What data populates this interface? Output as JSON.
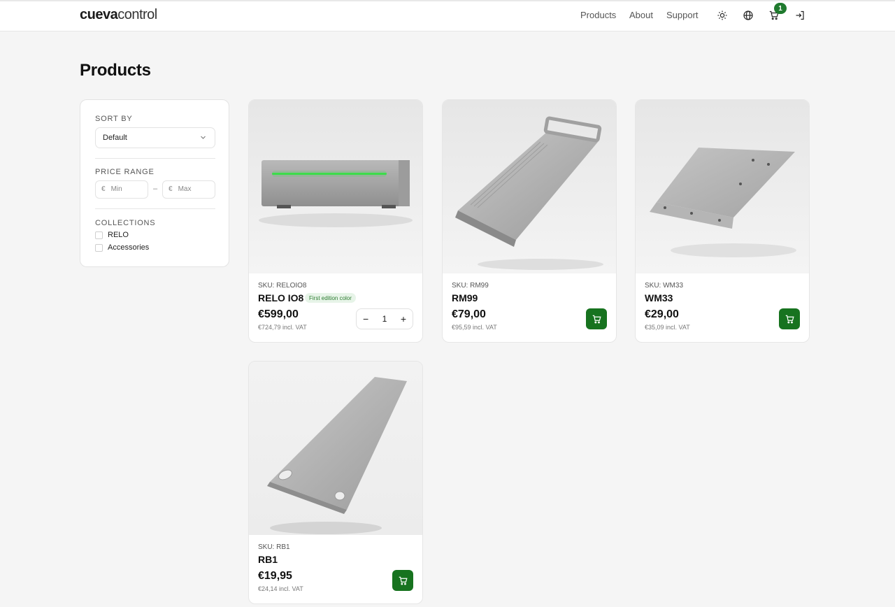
{
  "header": {
    "logo_bold": "cueva",
    "logo_light": "control",
    "nav": [
      "Products",
      "About",
      "Support"
    ],
    "cart_count": "1"
  },
  "page": {
    "title": "Products"
  },
  "filters": {
    "sort_label": "SORT BY",
    "sort_value": "Default",
    "price_label": "PRICE RANGE",
    "currency": "€",
    "min_placeholder": "Min",
    "max_placeholder": "Max",
    "price_separator": "–",
    "collections_label": "COLLECTIONS",
    "collections": [
      "RELO",
      "Accessories"
    ]
  },
  "products": [
    {
      "sku": "SKU: RELOIO8",
      "name": "RELO IO8",
      "badge": "First edition color",
      "price": "€599,00",
      "vat": "€724,79 incl. VAT",
      "quantity": "1"
    },
    {
      "sku": "SKU: RM99",
      "name": "RM99",
      "price": "€79,00",
      "vat": "€95,59 incl. VAT"
    },
    {
      "sku": "SKU: WM33",
      "name": "WM33",
      "price": "€29,00",
      "vat": "€35,09 incl. VAT"
    },
    {
      "sku": "SKU: RB1",
      "name": "RB1",
      "price": "€19,95",
      "vat": "€24,14 incl. VAT"
    }
  ],
  "colors": {
    "accent": "#17731f",
    "badge_bg": "#e7f4e8",
    "badge_text": "#2e7d32"
  }
}
